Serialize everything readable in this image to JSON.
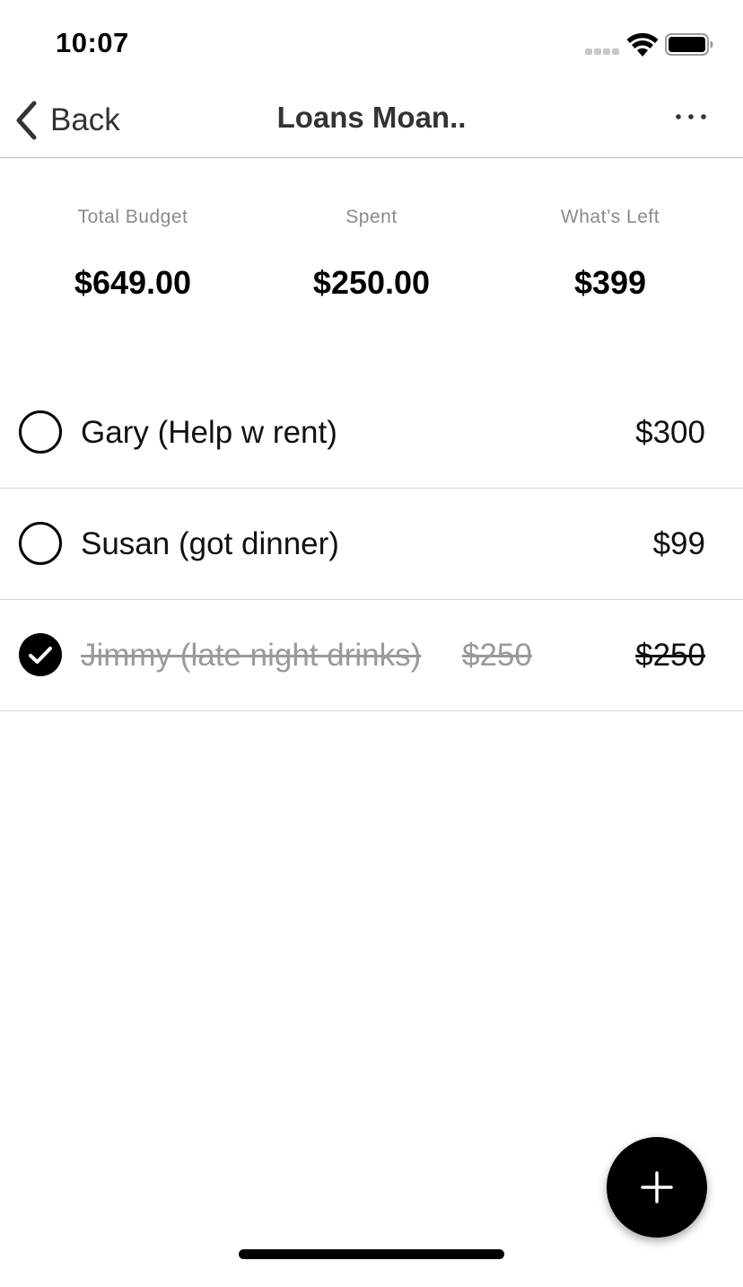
{
  "status_bar": {
    "time": "10:07",
    "icons": [
      "cellular-signal-icon",
      "wifi-icon",
      "battery-icon"
    ]
  },
  "nav": {
    "back_label": "Back",
    "title": "Loans Moan..",
    "icons": [
      "chevron-left-icon",
      "more-horizontal-icon"
    ]
  },
  "summary": {
    "total_budget": {
      "label": "Total Budget",
      "value": "$649.00"
    },
    "spent": {
      "label": "Spent",
      "value": "$250.00"
    },
    "left": {
      "label": "What’s Left",
      "value": "$399"
    }
  },
  "items": [
    {
      "name": "Gary (Help w rent)",
      "amount": "$300",
      "checked": false
    },
    {
      "name": "Susan (got dinner)",
      "amount": "$99",
      "checked": false
    },
    {
      "name": "Jimmy (late night drinks)",
      "mid_amount": "$250",
      "amount": "$250",
      "checked": true
    }
  ],
  "fab": {
    "icon": "plus-icon"
  },
  "colors": {
    "accent": "#000000",
    "muted_text": "#8a8a8a",
    "divider": "#d6d6d6"
  }
}
